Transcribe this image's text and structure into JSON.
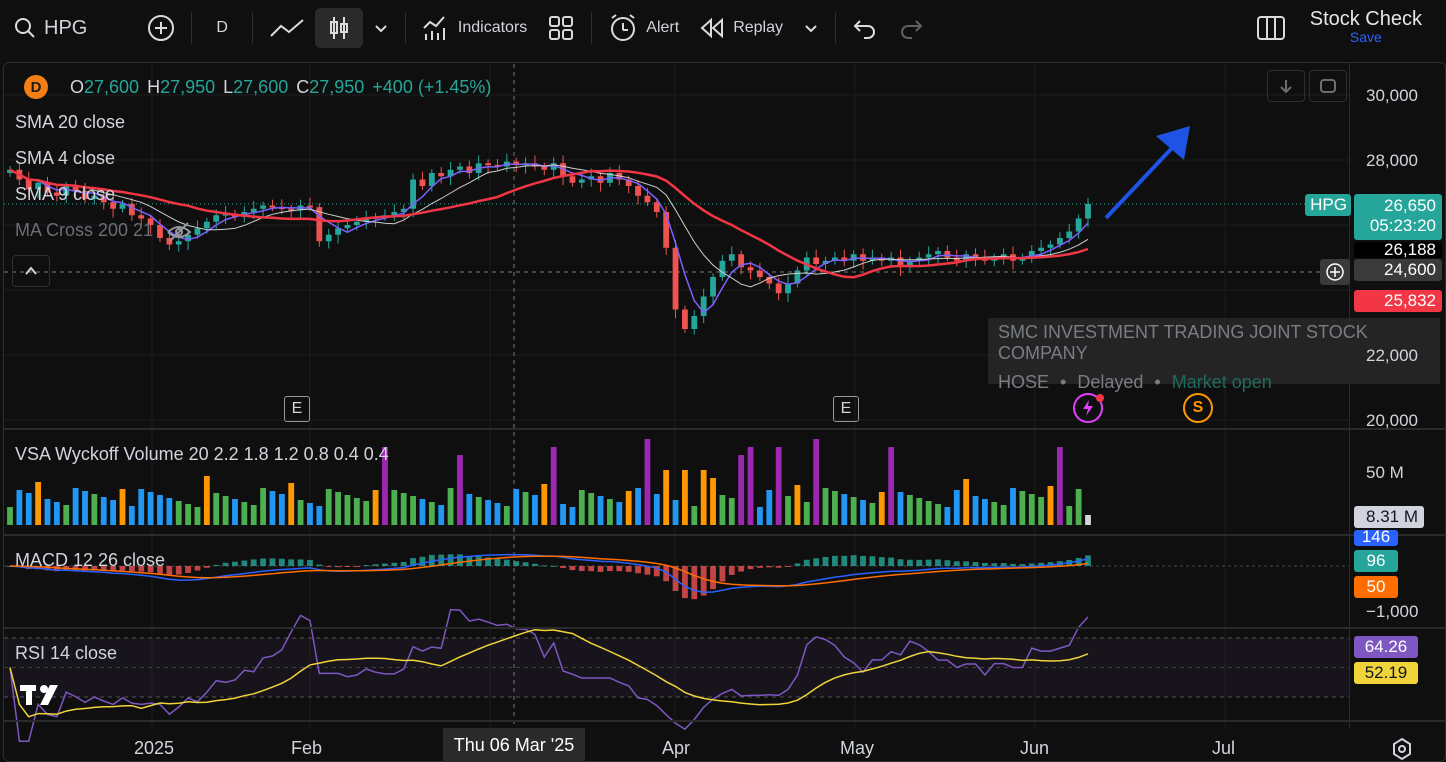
{
  "toolbar": {
    "symbol": "HPG",
    "interval": "D",
    "indicators_label": "Indicators",
    "alert_label": "Alert",
    "replay_label": "Replay",
    "layout_name": "Stock Check",
    "save_label": "Save"
  },
  "legend": {
    "interval_badge": "D",
    "open_label": "O",
    "open": "27,600",
    "high_label": "H",
    "high": "27,950",
    "low_label": "L",
    "low": "27,600",
    "close_label": "C",
    "close": "27,950",
    "change": "+400 (+1.45%)",
    "sma20": "SMA 20 close",
    "sma4": "SMA 4 close",
    "sma9": "SMA 9 close",
    "macross": "MA Cross 200 21",
    "vsa": "VSA Wyckoff Volume 20 2.2 1.8 1.2 0.8 0.4 0.4",
    "macd": "MACD 12 26 close",
    "rsi": "RSI 14 close"
  },
  "info": {
    "company": "SMC INVESTMENT TRADING JOINT STOCK COMPANY",
    "exchange": "HOSE",
    "status": "Delayed",
    "market": "Market open"
  },
  "price_axis": {
    "ticks": [
      "30,000",
      "28,000",
      "22,000",
      "20,000"
    ],
    "tag_symbol": "HPG",
    "tag_price": "26,650",
    "tag_countdown": "05:23:20",
    "tag_sma": "26,188",
    "tag_cross": "24,600",
    "tag_ma": "25,832",
    "vol_tick": "50 M",
    "vol_tag": "8.31 M",
    "macd_tag1": "146",
    "macd_tag2": "96",
    "macd_tag3": "50",
    "macd_tick": "−1,000",
    "rsi_tag1": "64.26",
    "rsi_tag2": "52.19"
  },
  "x_axis": {
    "labels": [
      "2025",
      "Feb",
      "Apr",
      "May",
      "Jun",
      "Jul"
    ],
    "crosshair": "Thu 06 Mar '25"
  },
  "events": {
    "earnings": "E",
    "split": "S"
  },
  "colors": {
    "up": "#26a69a",
    "down": "#ef5350",
    "sma20": "#f23645",
    "sma4": "#7b61ff",
    "arrow": "#1e53e5",
    "rsi": "#7e57c2",
    "rsi_ma": "#f0d43a"
  },
  "chart_data": {
    "type": "candlestick",
    "symbol": "HPG",
    "interval": "D",
    "x_labels": [
      "2025",
      "Feb",
      "Apr",
      "May",
      "Jun",
      "Jul"
    ],
    "ylim": [
      20000,
      30000
    ],
    "closes": [
      27700,
      27400,
      27100,
      27300,
      27000,
      26900,
      27200,
      27050,
      26800,
      26900,
      26700,
      26500,
      26650,
      26300,
      26200,
      26000,
      25600,
      25400,
      25500,
      25700,
      25900,
      26100,
      26300,
      26350,
      26250,
      26400,
      26500,
      26600,
      26550,
      26500,
      26450,
      26600,
      26550,
      25500,
      25700,
      25900,
      26000,
      26100,
      26200,
      26250,
      26300,
      26400,
      26500,
      27400,
      27200,
      27600,
      27500,
      27700,
      27800,
      27600,
      27900,
      27850,
      27800,
      27950,
      27850,
      27900,
      27800,
      27700,
      27900,
      27500,
      27300,
      27400,
      27500,
      27300,
      27600,
      27400,
      27200,
      26900,
      26700,
      26400,
      25300,
      23400,
      22800,
      23200,
      23800,
      24400,
      24900,
      25100,
      24700,
      24600,
      24400,
      24200,
      23900,
      24200,
      24600,
      25000,
      24800,
      24900,
      25000,
      24900,
      25100,
      24900,
      25000,
      24900,
      25000,
      24700,
      24900,
      25000,
      25100,
      25200,
      25000,
      24900,
      25100,
      25000,
      24900,
      25000,
      25100,
      24900,
      25000,
      25200,
      25300,
      25400,
      25600,
      25800,
      26200,
      26650
    ],
    "volume_unit": "M",
    "rsi": {
      "last": 64.26,
      "ma": 52.19
    },
    "macd": {
      "values": [
        146,
        96,
        50
      ]
    }
  }
}
